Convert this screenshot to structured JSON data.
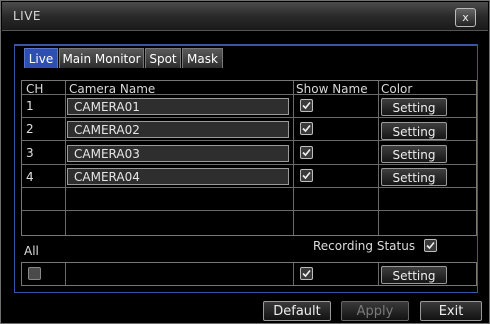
{
  "window": {
    "title": "LIVE",
    "close_label": "x"
  },
  "tabs": [
    {
      "label": "Live",
      "active": true
    },
    {
      "label": "Main Monitor",
      "active": false
    },
    {
      "label": "Spot",
      "active": false
    },
    {
      "label": "Mask",
      "active": false
    }
  ],
  "table": {
    "headers": {
      "ch": "CH",
      "camera_name": "Camera Name",
      "show_name": "Show Name",
      "color": "Color"
    },
    "rows": [
      {
        "ch": "1",
        "camera_name": "CAMERA01",
        "show_name": true,
        "color_btn": "Setting"
      },
      {
        "ch": "2",
        "camera_name": "CAMERA02",
        "show_name": true,
        "color_btn": "Setting"
      },
      {
        "ch": "3",
        "camera_name": "CAMERA03",
        "show_name": true,
        "color_btn": "Setting"
      },
      {
        "ch": "4",
        "camera_name": "CAMERA04",
        "show_name": true,
        "color_btn": "Setting"
      }
    ]
  },
  "all": {
    "label": "All",
    "recording_status_label": "Recording Status",
    "recording_status_checked": true,
    "select_all_checked": false,
    "show_name_checked": true,
    "color_btn": "Setting"
  },
  "buttons": {
    "default": "Default",
    "apply": "Apply",
    "exit": "Exit"
  },
  "colors": {
    "accent": "#2f4fb0",
    "panel_border": "#3b55a6",
    "background": "#000000"
  }
}
